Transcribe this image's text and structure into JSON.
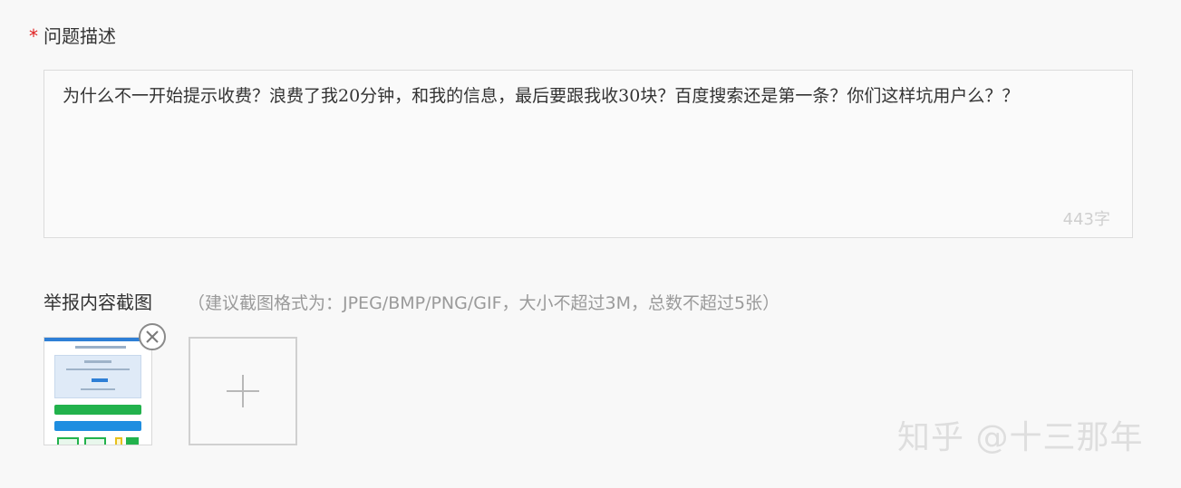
{
  "description": {
    "required_mark": "*",
    "label": "问题描述",
    "text": "为什么不一开始提示收费？浪费了我20分钟，和我的信息，最后要跟我收30块？百度搜索还是第一条？你们这样坑用户么？？",
    "char_count": "443字"
  },
  "upload": {
    "label": "举报内容截图",
    "hint": "（建议截图格式为：JPEG/BMP/PNG/GIF，大小不超过3M，总数不超过5张）",
    "thumbnails": [
      {
        "type": "screenshot"
      }
    ],
    "add_icon": "plus-icon",
    "remove_icon": "close-icon"
  },
  "watermark": "知乎 @十三那年",
  "colors": {
    "required": "#e02020",
    "hint": "#9a9a9a",
    "border": "#dcdcdc",
    "count": "#cfcfcf"
  }
}
